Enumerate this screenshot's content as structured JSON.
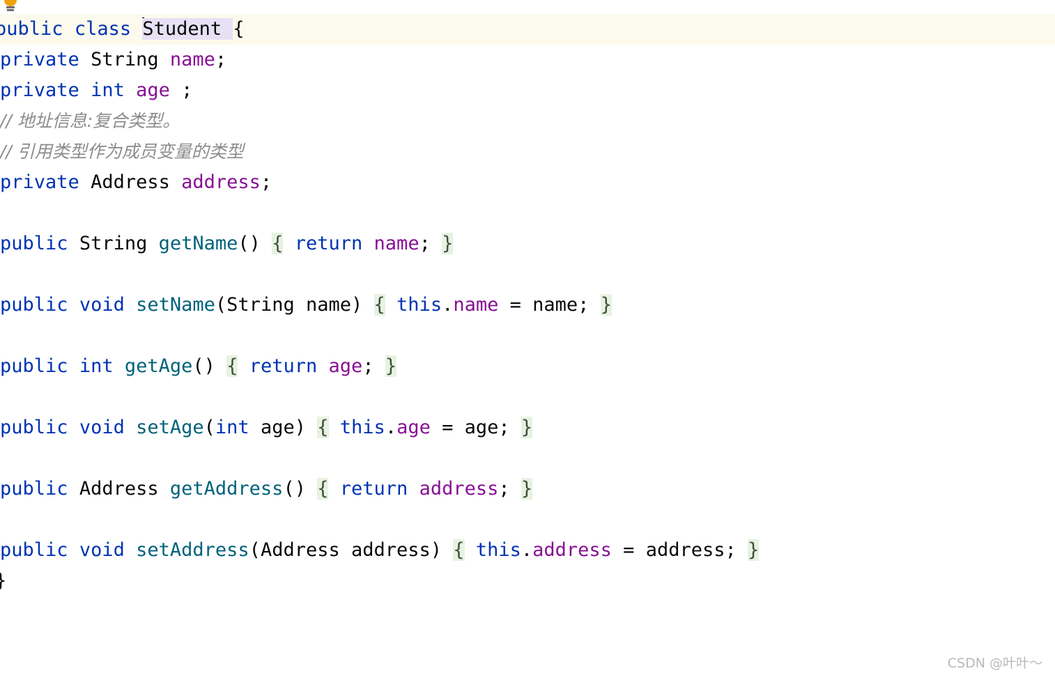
{
  "app": {
    "name": "IntelliJ IDEA Java Editor",
    "file_class": "Student"
  },
  "icons": {
    "intention_bulb": "lightbulb-icon"
  },
  "colors": {
    "background": "#ffffff",
    "current_line_highlight": "#fcfaec",
    "identifier_occurrence_highlight": "#e6e1f5",
    "matching_brace_highlight": "#e7f2e0",
    "keyword": "#0033b3",
    "field": "#871094",
    "method": "#00627a",
    "comment": "#8c8c8c",
    "default_text": "#080808",
    "caret": "#000000",
    "watermark": "#b9b9b9"
  },
  "editor": {
    "caret_line_index": 0,
    "caret_column_text": "Student",
    "lines": [
      {
        "index": 0,
        "current": true,
        "indent": 0,
        "tokens": [
          {
            "t": "kw",
            "s": "public"
          },
          {
            "t": "plain",
            "s": " "
          },
          {
            "t": "kw",
            "s": "class"
          },
          {
            "t": "plain",
            "s": " "
          },
          {
            "t": "caret",
            "s": ""
          },
          {
            "t": "idhl",
            "s": "Student "
          },
          {
            "t": "plain",
            "s": "{"
          }
        ]
      },
      {
        "index": 1,
        "current": false,
        "indent": 1,
        "tokens": [
          {
            "t": "kw",
            "s": "private"
          },
          {
            "t": "plain",
            "s": " "
          },
          {
            "t": "type",
            "s": "String"
          },
          {
            "t": "plain",
            "s": " "
          },
          {
            "t": "fld",
            "s": "name"
          },
          {
            "t": "plain",
            "s": ";"
          }
        ]
      },
      {
        "index": 2,
        "current": false,
        "indent": 1,
        "tokens": [
          {
            "t": "kw",
            "s": "private"
          },
          {
            "t": "plain",
            "s": " "
          },
          {
            "t": "kw",
            "s": "int"
          },
          {
            "t": "plain",
            "s": " "
          },
          {
            "t": "fld",
            "s": "age"
          },
          {
            "t": "plain",
            "s": " ;"
          }
        ]
      },
      {
        "index": 3,
        "current": false,
        "indent": 1,
        "tokens": [
          {
            "t": "cmt",
            "s": "// 地址信息:复合类型。"
          }
        ]
      },
      {
        "index": 4,
        "current": false,
        "indent": 1,
        "tokens": [
          {
            "t": "cmt",
            "s": "// 引用类型作为成员变量的类型"
          }
        ]
      },
      {
        "index": 5,
        "current": false,
        "indent": 1,
        "tokens": [
          {
            "t": "kw",
            "s": "private"
          },
          {
            "t": "plain",
            "s": " "
          },
          {
            "t": "type",
            "s": "Address"
          },
          {
            "t": "plain",
            "s": " "
          },
          {
            "t": "fld",
            "s": "address"
          },
          {
            "t": "plain",
            "s": ";"
          }
        ]
      },
      {
        "index": 6,
        "current": false,
        "indent": 1,
        "tokens": []
      },
      {
        "index": 7,
        "current": false,
        "indent": 1,
        "tokens": [
          {
            "t": "kw",
            "s": "public"
          },
          {
            "t": "plain",
            "s": " "
          },
          {
            "t": "type",
            "s": "String"
          },
          {
            "t": "plain",
            "s": " "
          },
          {
            "t": "mth",
            "s": "getName"
          },
          {
            "t": "plain",
            "s": "() "
          },
          {
            "t": "brace",
            "s": "{"
          },
          {
            "t": "plain",
            "s": " "
          },
          {
            "t": "kw",
            "s": "return"
          },
          {
            "t": "plain",
            "s": " "
          },
          {
            "t": "fld",
            "s": "name"
          },
          {
            "t": "plain",
            "s": "; "
          },
          {
            "t": "brace",
            "s": "}"
          }
        ]
      },
      {
        "index": 8,
        "current": false,
        "indent": 1,
        "tokens": []
      },
      {
        "index": 9,
        "current": false,
        "indent": 1,
        "tokens": [
          {
            "t": "kw",
            "s": "public"
          },
          {
            "t": "plain",
            "s": " "
          },
          {
            "t": "kw",
            "s": "void"
          },
          {
            "t": "plain",
            "s": " "
          },
          {
            "t": "mth",
            "s": "setName"
          },
          {
            "t": "plain",
            "s": "("
          },
          {
            "t": "type",
            "s": "String"
          },
          {
            "t": "plain",
            "s": " name) "
          },
          {
            "t": "brace",
            "s": "{"
          },
          {
            "t": "plain",
            "s": " "
          },
          {
            "t": "kw",
            "s": "this"
          },
          {
            "t": "plain",
            "s": "."
          },
          {
            "t": "fld",
            "s": "name"
          },
          {
            "t": "plain",
            "s": " = name; "
          },
          {
            "t": "brace",
            "s": "}"
          }
        ]
      },
      {
        "index": 10,
        "current": false,
        "indent": 1,
        "tokens": []
      },
      {
        "index": 11,
        "current": false,
        "indent": 1,
        "tokens": [
          {
            "t": "kw",
            "s": "public"
          },
          {
            "t": "plain",
            "s": " "
          },
          {
            "t": "kw",
            "s": "int"
          },
          {
            "t": "plain",
            "s": " "
          },
          {
            "t": "mth",
            "s": "getAge"
          },
          {
            "t": "plain",
            "s": "() "
          },
          {
            "t": "brace",
            "s": "{"
          },
          {
            "t": "plain",
            "s": " "
          },
          {
            "t": "kw",
            "s": "return"
          },
          {
            "t": "plain",
            "s": " "
          },
          {
            "t": "fld",
            "s": "age"
          },
          {
            "t": "plain",
            "s": "; "
          },
          {
            "t": "brace",
            "s": "}"
          }
        ]
      },
      {
        "index": 12,
        "current": false,
        "indent": 1,
        "tokens": []
      },
      {
        "index": 13,
        "current": false,
        "indent": 1,
        "tokens": [
          {
            "t": "kw",
            "s": "public"
          },
          {
            "t": "plain",
            "s": " "
          },
          {
            "t": "kw",
            "s": "void"
          },
          {
            "t": "plain",
            "s": " "
          },
          {
            "t": "mth",
            "s": "setAge"
          },
          {
            "t": "plain",
            "s": "("
          },
          {
            "t": "kw",
            "s": "int"
          },
          {
            "t": "plain",
            "s": " age) "
          },
          {
            "t": "brace",
            "s": "{"
          },
          {
            "t": "plain",
            "s": " "
          },
          {
            "t": "kw",
            "s": "this"
          },
          {
            "t": "plain",
            "s": "."
          },
          {
            "t": "fld",
            "s": "age"
          },
          {
            "t": "plain",
            "s": " = age; "
          },
          {
            "t": "brace",
            "s": "}"
          }
        ]
      },
      {
        "index": 14,
        "current": false,
        "indent": 1,
        "tokens": []
      },
      {
        "index": 15,
        "current": false,
        "indent": 1,
        "tokens": [
          {
            "t": "kw",
            "s": "public"
          },
          {
            "t": "plain",
            "s": " "
          },
          {
            "t": "type",
            "s": "Address"
          },
          {
            "t": "plain",
            "s": " "
          },
          {
            "t": "mth",
            "s": "getAddress"
          },
          {
            "t": "plain",
            "s": "() "
          },
          {
            "t": "brace",
            "s": "{"
          },
          {
            "t": "plain",
            "s": " "
          },
          {
            "t": "kw",
            "s": "return"
          },
          {
            "t": "plain",
            "s": " "
          },
          {
            "t": "fld",
            "s": "address"
          },
          {
            "t": "plain",
            "s": "; "
          },
          {
            "t": "brace",
            "s": "}"
          }
        ]
      },
      {
        "index": 16,
        "current": false,
        "indent": 1,
        "tokens": []
      },
      {
        "index": 17,
        "current": false,
        "indent": 1,
        "tokens": [
          {
            "t": "kw",
            "s": "public"
          },
          {
            "t": "plain",
            "s": " "
          },
          {
            "t": "kw",
            "s": "void"
          },
          {
            "t": "plain",
            "s": " "
          },
          {
            "t": "mth",
            "s": "setAddress"
          },
          {
            "t": "plain",
            "s": "("
          },
          {
            "t": "type",
            "s": "Address"
          },
          {
            "t": "plain",
            "s": " address) "
          },
          {
            "t": "brace",
            "s": "{"
          },
          {
            "t": "plain",
            "s": " "
          },
          {
            "t": "kw",
            "s": "this"
          },
          {
            "t": "plain",
            "s": "."
          },
          {
            "t": "fld",
            "s": "address"
          },
          {
            "t": "plain",
            "s": " = address; "
          },
          {
            "t": "brace",
            "s": "}"
          }
        ]
      },
      {
        "index": 18,
        "current": false,
        "indent": 0,
        "tokens": [
          {
            "t": "plain",
            "s": "}"
          }
        ]
      }
    ]
  },
  "watermark": {
    "text": "CSDN @叶叶～"
  }
}
